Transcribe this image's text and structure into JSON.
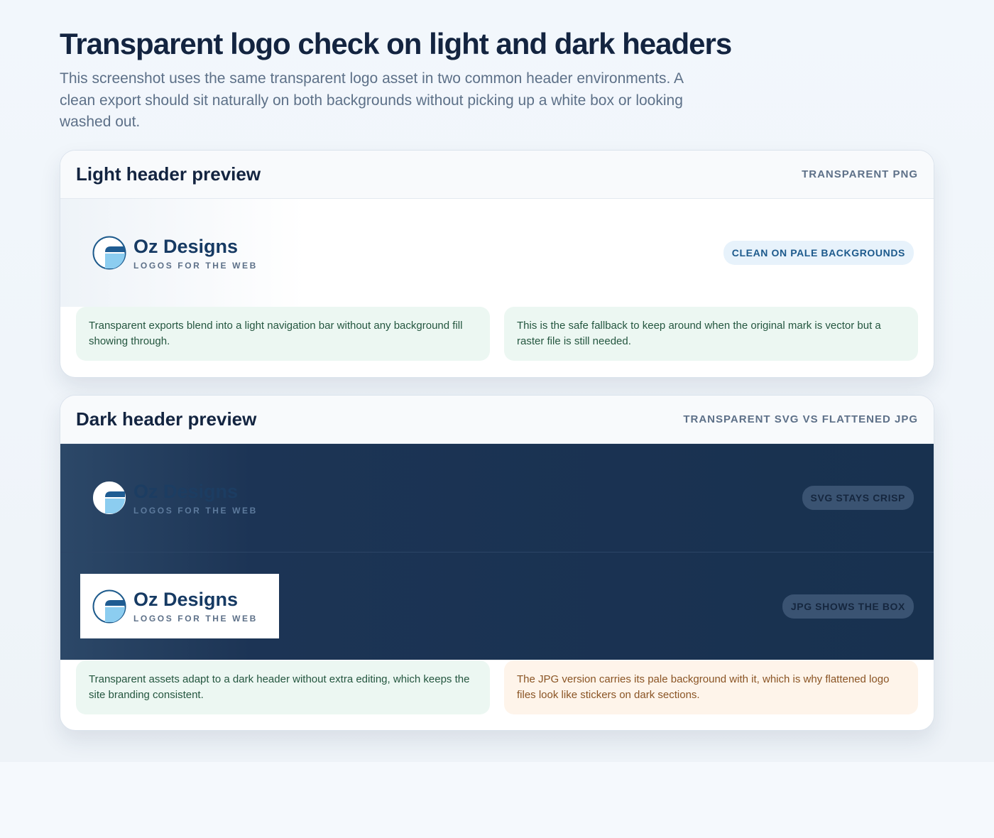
{
  "page": {
    "title": "Transparent logo check on light and dark headers",
    "subtitle": "This screenshot uses the same transparent logo asset in two common header environments. A clean export should sit naturally on both backgrounds without picking up a white box or looking washed out."
  },
  "logo": {
    "name": "Oz Designs",
    "tagline": "LOGOS FOR THE WEB",
    "icon": "oz-designs-mark-icon"
  },
  "light_card": {
    "title": "Light header preview",
    "tag": "TRANSPARENT PNG",
    "preview_badge": "CLEAN ON PALE BACKGROUNDS",
    "notes": [
      "Transparent exports blend into a light navigation bar without any background fill showing through.",
      "This is the safe fallback to keep around when the original mark is vector but a raster file is still needed."
    ]
  },
  "dark_card": {
    "title": "Dark header preview",
    "tag": "TRANSPARENT SVG VS FLATTENED JPG",
    "svg_badge": "SVG STAYS CRISP",
    "jpg_badge": "JPG SHOWS THE BOX",
    "notes": [
      "Transparent assets adapt to a dark header without extra editing, which keeps the site branding consistent.",
      "The JPG version carries its pale background with it, which is why flattened logo files look like stickers on dark sections."
    ]
  },
  "colors": {
    "navy": "#163a63",
    "dark_header": "#18314f",
    "note_green_bg": "#ecf7f2",
    "note_orange_bg": "#fef4ea",
    "badge_light_bg": "#e7f2fb"
  }
}
